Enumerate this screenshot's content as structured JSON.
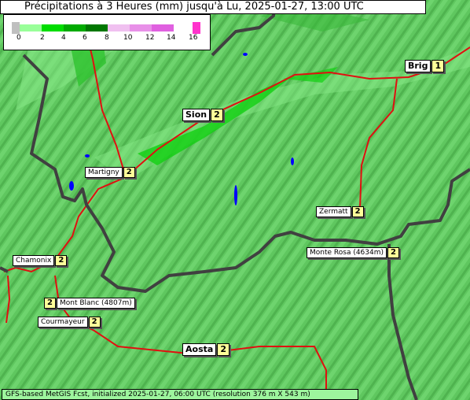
{
  "title": "Précipitations à 3 Heures (mm) jusqu'à Lu, 2025-01-27, 13:00 UTC",
  "legend": {
    "ticks": [
      "0",
      "2",
      "4",
      "6",
      "8",
      "10",
      "12",
      "14",
      "16"
    ],
    "colors": [
      "#bfbfbf",
      "#99ff99",
      "#00dd00",
      "#00aa00",
      "#007700",
      "#f0c0f0",
      "#e890e8",
      "#e060e0",
      "#ff33cc"
    ]
  },
  "cities": [
    {
      "name": "Brig",
      "value": "1"
    },
    {
      "name": "Sion",
      "value": "2"
    },
    {
      "name": "Martigny",
      "value": "2"
    },
    {
      "name": "Zermatt",
      "value": "2"
    },
    {
      "name": "Monte Rosa (4634m)",
      "value": "2"
    },
    {
      "name": "Chamonix",
      "value": "2"
    },
    {
      "name": "Mont Blanc (4807m)",
      "value": "2"
    },
    {
      "name": "Courmayeur",
      "value": "2"
    },
    {
      "name": "Aosta",
      "value": "2"
    }
  ],
  "footer": "GFS-based MetGIS Fcst, initialized 2025-01-27, 06:00 UTC  (resolution 376 m X 543 m)",
  "colors": {
    "terrain": "#5fc75f",
    "rivers_roads": "#e01010",
    "borders": "#404040",
    "lakes": "#0000ff"
  }
}
